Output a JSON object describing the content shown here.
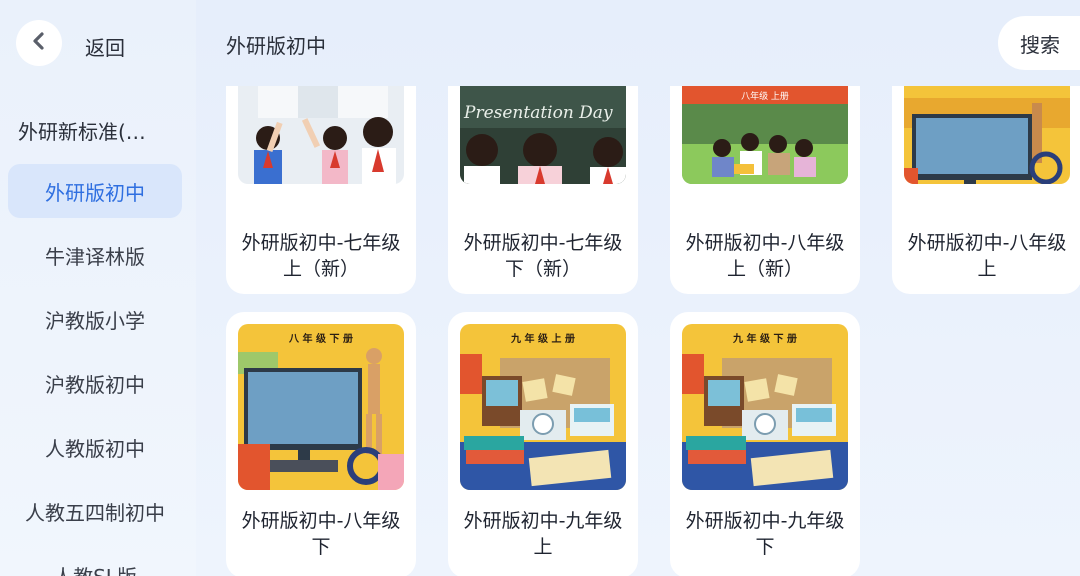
{
  "nav": {
    "back_label": "返回",
    "series_title": "外研新标准(…",
    "items": [
      {
        "label": "外研版初中",
        "active": true
      },
      {
        "label": "牛津译林版",
        "active": false
      },
      {
        "label": "沪教版小学",
        "active": false
      },
      {
        "label": "沪教版初中",
        "active": false
      },
      {
        "label": "人教版初中",
        "active": false
      },
      {
        "label": "人教五四制初中",
        "active": false
      },
      {
        "label": "人教SL版",
        "active": false
      }
    ]
  },
  "header": {
    "title": "外研版初中",
    "search_label": "搜索"
  },
  "books": [
    {
      "title": "外研版初中-七年级上（新）",
      "cover_text": ""
    },
    {
      "title": "外研版初中-七年级下（新）",
      "cover_text": "Presentation Day"
    },
    {
      "title": "外研版初中-八年级上（新）",
      "cover_text": "八年级 上册"
    },
    {
      "title": "外研版初中-八年级上",
      "cover_text": ""
    },
    {
      "title": "外研版初中-八年级下",
      "cover_text": "八 年 级   下 册"
    },
    {
      "title": "外研版初中-九年级上",
      "cover_text": "九 年 级   上 册"
    },
    {
      "title": "外研版初中-九年级下",
      "cover_text": "九 年 级   下 册"
    }
  ],
  "colors": {
    "accent": "#2f6fe0",
    "active_bg": "#d9e6fb"
  }
}
